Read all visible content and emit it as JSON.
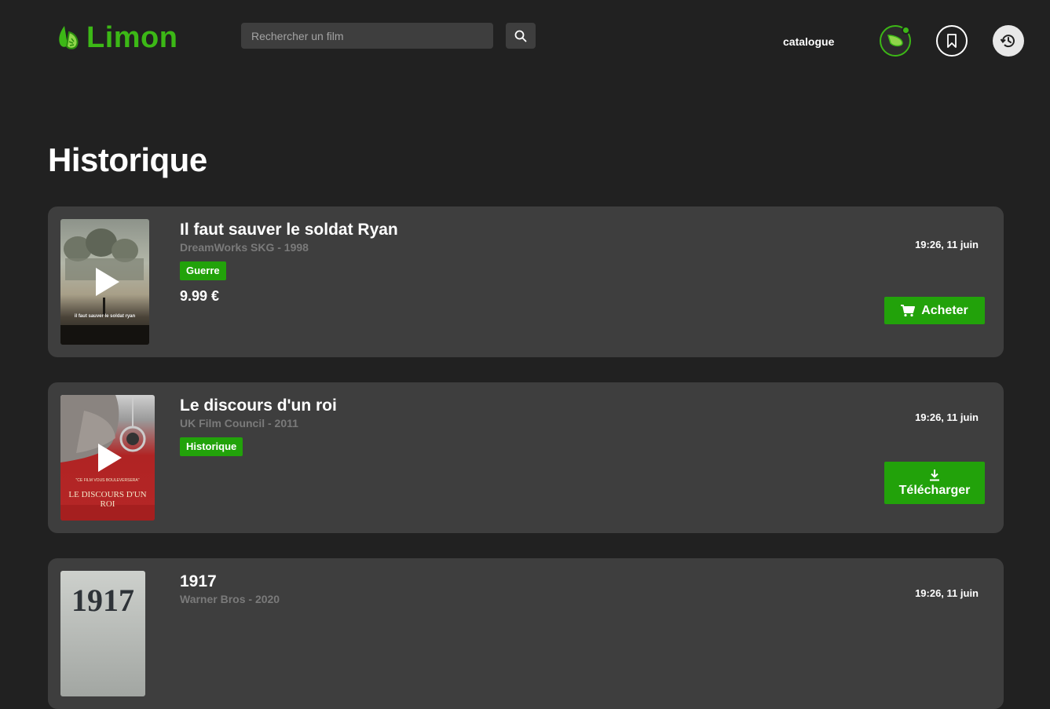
{
  "header": {
    "logo_text": "Limon",
    "search_placeholder": "Rechercher un film",
    "nav_catalogue": "catalogue",
    "brand_color": "#3cb816"
  },
  "page_title": "Historique",
  "history": [
    {
      "title": "Il faut sauver le soldat Ryan",
      "subtitle": "DreamWorks SKG - 1998",
      "genre": "Guerre",
      "price": "9.99 €",
      "date": "19:26, 11 juin",
      "action_label": "Acheter",
      "action_icon": "cart-icon"
    },
    {
      "title": "Le discours d'un roi",
      "subtitle": "UK Film Council - 2011",
      "genre": "Historique",
      "date": "19:26, 11 juin",
      "action_label": "Télécharger",
      "action_icon": "download-icon"
    },
    {
      "title": "1917",
      "subtitle": "Warner Bros - 2020",
      "date": "19:26, 11 juin"
    }
  ],
  "posters": {
    "ryan_text": "il faut sauver le soldat ryan",
    "roi_quote": "\"CE FILM VOUS BOULEVERSERA\"",
    "roi_text": "LE DISCOURS D'UN ROI",
    "film1917_text": "1917"
  }
}
